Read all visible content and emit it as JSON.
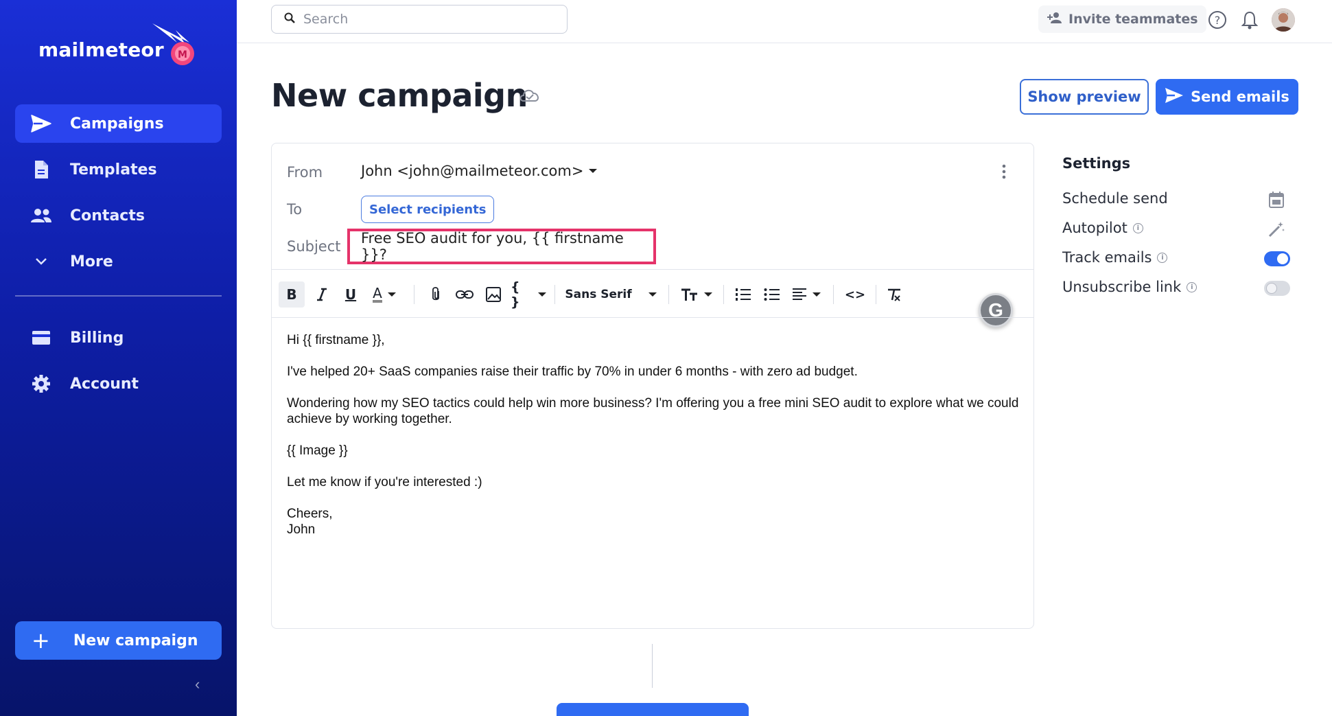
{
  "app": {
    "name": "mailmeteor"
  },
  "sidebar": {
    "items": [
      {
        "label": "Campaigns",
        "icon": "paper-plane-icon",
        "active": true
      },
      {
        "label": "Templates",
        "icon": "document-icon"
      },
      {
        "label": "Contacts",
        "icon": "people-icon"
      },
      {
        "label": "More",
        "icon": "chevron-down-icon"
      },
      {
        "label": "Billing",
        "icon": "credit-card-icon"
      },
      {
        "label": "Account",
        "icon": "gear-icon"
      }
    ],
    "new_campaign_label": "New campaign",
    "collapse_icon": "chevron-left-icon"
  },
  "topbar": {
    "search_placeholder": "Search",
    "invite_label": "Invite teammates",
    "icons": [
      "help-icon",
      "bell-icon",
      "avatar"
    ]
  },
  "header": {
    "title": "New campaign",
    "status_icon": "cloud-check-icon",
    "preview_label": "Show preview",
    "send_label": "Send emails"
  },
  "composer": {
    "from_label": "From",
    "from_value": "John <john@mailmeteor.com>",
    "to_label": "To",
    "to_button": "Select recipients",
    "subject_label": "Subject",
    "subject_value": "Free SEO audit for you, {{ firstname }}?",
    "toolbar": {
      "font": "Sans Serif",
      "underline_glyph": "U",
      "color_glyph": "A",
      "braces_glyph": "{ }",
      "code_glyph": "<>"
    },
    "body": {
      "greeting": "Hi {{ firstname }},",
      "para1": "I've helped 20+ SaaS companies raise their traffic by 70% in under 6 months - with zero ad budget.",
      "para2": "Wondering how my SEO tactics could help win more business? I'm offering you a free mini SEO audit to explore what we could achieve by working together.",
      "image_tag": "{{ Image }}",
      "para3": "Let me know if you're interested :)",
      "signoff": "Cheers,",
      "name": "John"
    }
  },
  "settings": {
    "title": "Settings",
    "items": [
      {
        "label": "Schedule send",
        "control": "calendar-icon"
      },
      {
        "label": "Autopilot",
        "info": true,
        "control": "magic-wand-icon"
      },
      {
        "label": "Track emails",
        "info": true,
        "control": "toggle",
        "enabled": true
      },
      {
        "label": "Unsubscribe link",
        "info": true,
        "control": "toggle",
        "enabled": false
      }
    ]
  },
  "colors": {
    "primary": "#2f6bf2",
    "sidebar_top": "#1a2fd6",
    "sidebar_bottom": "#07146a",
    "highlight": "#e5336a"
  }
}
